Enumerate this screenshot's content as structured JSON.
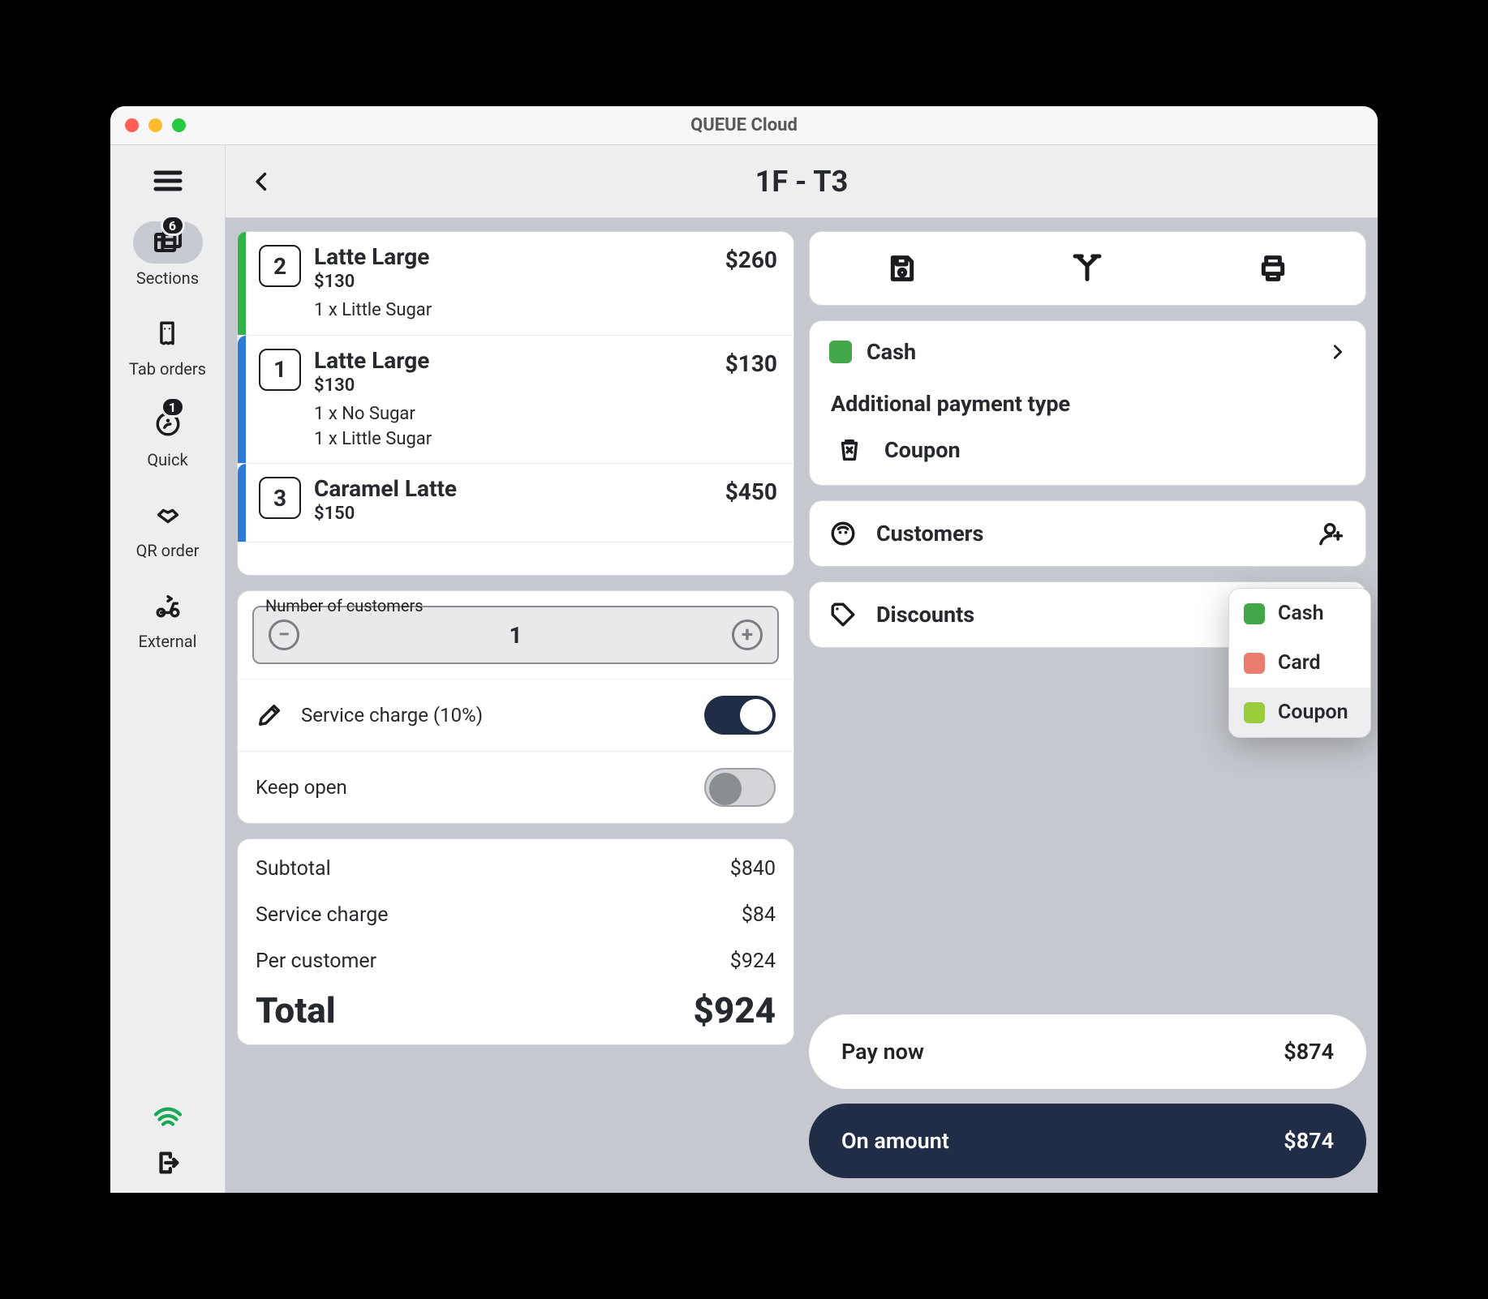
{
  "window": {
    "title": "QUEUE Cloud"
  },
  "header": {
    "title": "1F - T3"
  },
  "rail": {
    "items": [
      {
        "label": "Sections",
        "badge": "6",
        "active": true
      },
      {
        "label": "Tab orders"
      },
      {
        "label": "Quick",
        "badge": "1"
      },
      {
        "label": "QR order"
      },
      {
        "label": "External"
      }
    ]
  },
  "order": {
    "items": [
      {
        "stripe": "green",
        "qty": "2",
        "name": "Latte Large",
        "each": "$130",
        "mods": [
          "1 x Little Sugar"
        ],
        "price": "$260"
      },
      {
        "stripe": "blue",
        "qty": "1",
        "name": "Latte Large",
        "each": "$130",
        "mods": [
          "1 x No Sugar",
          "1 x Little Sugar"
        ],
        "price": "$130"
      },
      {
        "stripe": "blue",
        "qty": "3",
        "name": "Caramel Latte",
        "each": "$150",
        "mods": [],
        "price": "$450"
      }
    ]
  },
  "settings": {
    "customers_label": "Number of customers",
    "customers_value": "1",
    "service_charge_label": "Service charge (10%)",
    "service_charge_on": true,
    "keep_open_label": "Keep open",
    "keep_open_on": false
  },
  "totals": {
    "subtotal_label": "Subtotal",
    "subtotal_value": "$840",
    "service_label": "Service charge",
    "service_value": "$84",
    "per_label": "Per customer",
    "per_value": "$924",
    "total_label": "Total",
    "total_value": "$924"
  },
  "payment": {
    "primary_label": "Cash",
    "additional_label": "Additional payment type",
    "coupon_label": "Coupon",
    "customers_label": "Customers",
    "discounts_label": "Discounts",
    "pay_now_label": "Pay now",
    "pay_now_value": "$874",
    "on_amount_label": "On amount",
    "on_amount_value": "$874",
    "popover": [
      {
        "label": "Cash",
        "color": "#43a648"
      },
      {
        "label": "Card",
        "color": "#ea7d70"
      },
      {
        "label": "Coupon",
        "color": "#9acc3c",
        "selected": true
      }
    ]
  }
}
